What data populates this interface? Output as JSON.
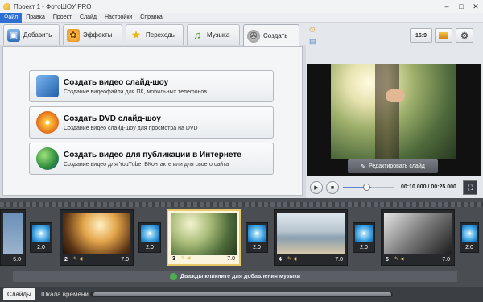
{
  "window": {
    "title": "Проект 1 - ФотоШОУ PRO"
  },
  "menu": [
    "Файл",
    "Правка",
    "Проект",
    "Слайд",
    "Настройки",
    "Справка"
  ],
  "tabs": [
    {
      "label": "Добавить",
      "icon": "add-photos-icon"
    },
    {
      "label": "Эффекты",
      "icon": "palette-icon"
    },
    {
      "label": "Переходы",
      "icon": "star-icon"
    },
    {
      "label": "Музыка",
      "icon": "music-note-icon"
    },
    {
      "label": "Создать",
      "icon": "film-reel-icon"
    }
  ],
  "actions": [
    {
      "title": "Создать видео слайд-шоу",
      "subtitle": "Создание видеофайла для ПК, мобильных телефонов"
    },
    {
      "title": "Создать DVD слайд-шоу",
      "subtitle": "Создание видео слайд-шоу для просмотра на DVD"
    },
    {
      "title": "Создать видео для публикации в Интернете",
      "subtitle": "Создание видео для YouTube, ВКонтакте или для своего сайта"
    }
  ],
  "preview": {
    "aspect_label": "16:9",
    "edit_label": "Редактировать слайд",
    "time": "00:10.000 / 00:25.000"
  },
  "timeline": {
    "slides": [
      {
        "num": "",
        "dur": "5.0"
      },
      {
        "num": "2",
        "dur": "7.0"
      },
      {
        "num": "3",
        "dur": "7.0"
      },
      {
        "num": "4",
        "dur": "7.0"
      },
      {
        "num": "5",
        "dur": "7.0"
      }
    ],
    "transitions": [
      "2.0",
      "2.0",
      "2.0",
      "2.0",
      "2.0"
    ],
    "music_hint": "Дважды кликните для добавления музыки"
  },
  "bottom_tabs": [
    "Слайды",
    "Шкала времени"
  ],
  "colors": {
    "accent": "#2d6fd2",
    "selected": "#e8c96a"
  }
}
